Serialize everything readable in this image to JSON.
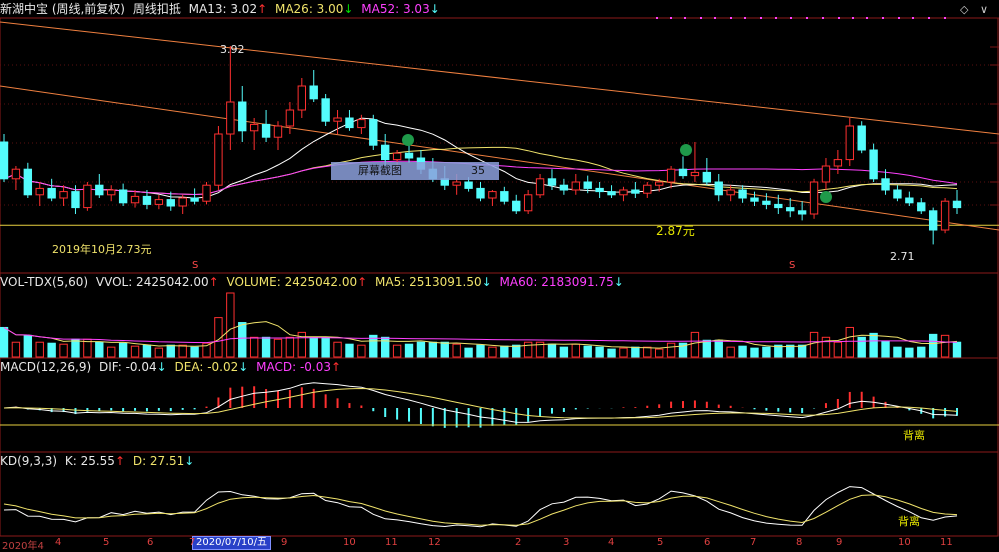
{
  "header": {
    "stock": "新湖中宝 (周线,前复权)",
    "mode": "周线扣抵",
    "ma13_label": "MA13: 3.02",
    "ma26_label": "MA26: 3.00",
    "ma52_label": "MA52: 3.03",
    "ma13_arrow": "↑",
    "ma26_arrow": "↓",
    "ma52_arrow": "↓"
  },
  "vol_header": {
    "name": "VOL-TDX(5,60)",
    "vvol": "VVOL: 2425042.00",
    "volume": "VOLUME: 2425042.00",
    "ma5": "MA5: 2513091.50",
    "ma60": "MA60: 2183091.75",
    "vvol_arrow": "↑",
    "volume_arrow": "↑",
    "ma5_arrow": "↓",
    "ma60_arrow": "↓"
  },
  "macd_header": {
    "name": "MACD(12,26,9)",
    "dif": "DIF: -0.04",
    "dea": "DEA: -0.02",
    "macd": "MACD: -0.03",
    "dif_arrow": "↓",
    "dea_arrow": "↓",
    "macd_arrow": "↑"
  },
  "kd_header": {
    "name": "KD(9,3,3)",
    "k": "K: 25.55",
    "d": "D: 27.51",
    "k_arrow": "↑",
    "d_arrow": "↓"
  },
  "annotations": {
    "high": "3.92",
    "low_2019": "2019年10月2.73元",
    "price_287": "2.87元",
    "low_271": "2.71",
    "divergence_macd": "背离",
    "divergence_kd": "背离",
    "tooltip_label": "屏幕截图",
    "tooltip_value": "35",
    "marker_s": "S"
  },
  "controls": {
    "diamond": "◇",
    "dropdown": "∨"
  },
  "x_axis": {
    "date_box": "2020/07/10/五",
    "ticks": [
      "4",
      "5",
      "6",
      "7",
      "9",
      "10",
      "11",
      "12",
      "2",
      "3",
      "4",
      "5",
      "6",
      "7",
      "8",
      "9",
      "10",
      "11"
    ],
    "left_label": "2020年4"
  },
  "colors": {
    "up": "#ff3030",
    "down": "#54fcfc",
    "ma13": "#f0e36b",
    "ma26": "#ffffff",
    "ma52": "#ff40ff",
    "trend": "#f08040"
  },
  "chart_data": {
    "type": "candlestick",
    "series_name": "新湖中宝 (周线,前复权)",
    "annotated_values": {
      "high": 3.92,
      "price_level": 2.87,
      "low": 2.71,
      "low_2019": 2.73
    },
    "ohlc": [
      [
        3.35,
        3.4,
        3.1,
        3.12
      ],
      [
        3.12,
        3.2,
        3.05,
        3.18
      ],
      [
        3.18,
        3.22,
        3.0,
        3.02
      ],
      [
        3.02,
        3.1,
        2.95,
        3.06
      ],
      [
        3.06,
        3.12,
        2.98,
        3.0
      ],
      [
        3.0,
        3.08,
        2.95,
        3.04
      ],
      [
        3.04,
        3.08,
        2.9,
        2.94
      ],
      [
        2.94,
        3.1,
        2.92,
        3.08
      ],
      [
        3.08,
        3.15,
        3.0,
        3.02
      ],
      [
        3.02,
        3.08,
        2.98,
        3.05
      ],
      [
        3.05,
        3.09,
        2.95,
        2.97
      ],
      [
        2.97,
        3.05,
        2.94,
        3.01
      ],
      [
        3.01,
        3.05,
        2.93,
        2.96
      ],
      [
        2.96,
        3.02,
        2.93,
        2.99
      ],
      [
        2.99,
        3.04,
        2.92,
        2.95
      ],
      [
        2.95,
        3.02,
        2.9,
        3.0
      ],
      [
        3.0,
        3.06,
        2.96,
        2.98
      ],
      [
        2.98,
        3.1,
        2.96,
        3.08
      ],
      [
        3.08,
        3.45,
        3.05,
        3.4
      ],
      [
        3.4,
        3.95,
        3.3,
        3.6
      ],
      [
        3.6,
        3.7,
        3.35,
        3.42
      ],
      [
        3.42,
        3.5,
        3.3,
        3.46
      ],
      [
        3.46,
        3.55,
        3.35,
        3.38
      ],
      [
        3.38,
        3.48,
        3.3,
        3.45
      ],
      [
        3.45,
        3.6,
        3.4,
        3.55
      ],
      [
        3.55,
        3.75,
        3.5,
        3.7
      ],
      [
        3.7,
        3.8,
        3.6,
        3.62
      ],
      [
        3.62,
        3.65,
        3.45,
        3.48
      ],
      [
        3.48,
        3.55,
        3.4,
        3.5
      ],
      [
        3.5,
        3.55,
        3.42,
        3.44
      ],
      [
        3.44,
        3.52,
        3.4,
        3.49
      ],
      [
        3.49,
        3.52,
        3.3,
        3.33
      ],
      [
        3.33,
        3.4,
        3.2,
        3.24
      ],
      [
        3.24,
        3.3,
        3.18,
        3.28
      ],
      [
        3.28,
        3.35,
        3.22,
        3.25
      ],
      [
        3.25,
        3.3,
        3.15,
        3.18
      ],
      [
        3.18,
        3.25,
        3.1,
        3.12
      ],
      [
        3.12,
        3.2,
        3.05,
        3.08
      ],
      [
        3.08,
        3.15,
        3.02,
        3.1
      ],
      [
        3.1,
        3.13,
        3.04,
        3.06
      ],
      [
        3.06,
        3.1,
        2.98,
        3.0
      ],
      [
        3.0,
        3.05,
        2.95,
        3.04
      ],
      [
        3.04,
        3.07,
        2.96,
        2.98
      ],
      [
        2.98,
        3.02,
        2.9,
        2.92
      ],
      [
        2.92,
        3.05,
        2.9,
        3.02
      ],
      [
        3.02,
        3.15,
        3.0,
        3.12
      ],
      [
        3.12,
        3.18,
        3.05,
        3.08
      ],
      [
        3.08,
        3.12,
        3.02,
        3.05
      ],
      [
        3.05,
        3.15,
        3.02,
        3.1
      ],
      [
        3.1,
        3.14,
        3.03,
        3.06
      ],
      [
        3.06,
        3.1,
        3.0,
        3.04
      ],
      [
        3.04,
        3.08,
        3.0,
        3.02
      ],
      [
        3.02,
        3.07,
        2.98,
        3.05
      ],
      [
        3.05,
        3.1,
        3.0,
        3.03
      ],
      [
        3.03,
        3.1,
        3.0,
        3.08
      ],
      [
        3.08,
        3.12,
        3.04,
        3.1
      ],
      [
        3.1,
        3.2,
        3.06,
        3.18
      ],
      [
        3.18,
        3.26,
        3.12,
        3.14
      ],
      [
        3.14,
        3.35,
        3.1,
        3.16
      ],
      [
        3.16,
        3.25,
        3.08,
        3.1
      ],
      [
        3.1,
        3.15,
        2.98,
        3.02
      ],
      [
        3.02,
        3.08,
        2.98,
        3.05
      ],
      [
        3.05,
        3.08,
        2.97,
        3.0
      ],
      [
        3.0,
        3.04,
        2.95,
        2.98
      ],
      [
        2.98,
        3.03,
        2.93,
        2.96
      ],
      [
        2.96,
        3.02,
        2.9,
        2.94
      ],
      [
        2.94,
        3.0,
        2.88,
        2.92
      ],
      [
        2.92,
        2.98,
        2.86,
        2.9
      ],
      [
        2.9,
        3.12,
        2.87,
        3.1
      ],
      [
        3.1,
        3.25,
        3.05,
        3.2
      ],
      [
        3.2,
        3.3,
        3.15,
        3.24
      ],
      [
        3.24,
        3.5,
        3.2,
        3.45
      ],
      [
        3.45,
        3.48,
        3.28,
        3.3
      ],
      [
        3.3,
        3.34,
        3.1,
        3.12
      ],
      [
        3.12,
        3.18,
        3.02,
        3.05
      ],
      [
        3.05,
        3.08,
        2.98,
        3.0
      ],
      [
        3.0,
        3.04,
        2.95,
        2.97
      ],
      [
        2.97,
        3.0,
        2.9,
        2.92
      ],
      [
        2.92,
        2.94,
        2.71,
        2.8
      ],
      [
        2.8,
        3.0,
        2.78,
        2.98
      ],
      [
        2.98,
        3.05,
        2.9,
        2.94
      ]
    ],
    "volume": [],
    "indicators": [
      "MA13",
      "MA26",
      "MA52",
      "VOL-TDX",
      "MACD",
      "KD"
    ]
  }
}
